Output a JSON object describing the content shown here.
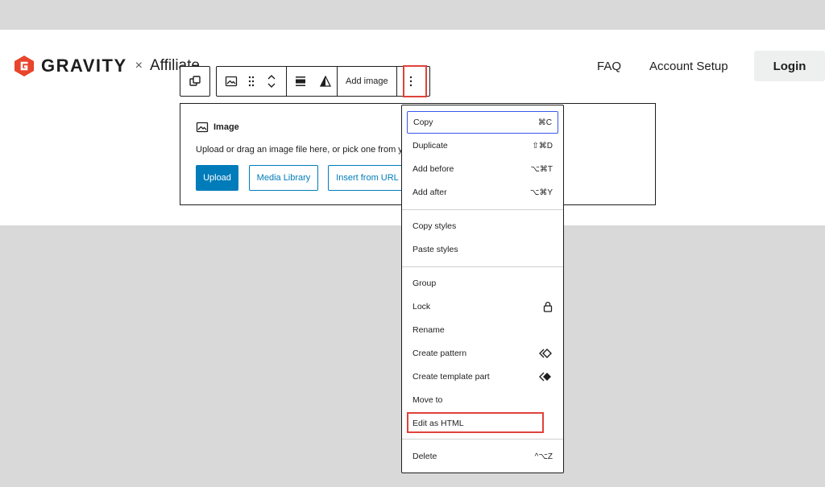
{
  "site": {
    "logo_text": "GRAVITY",
    "logo_separator": "×",
    "logo_partner": "Affiliate",
    "nav": [
      "FAQ",
      "Account Setup"
    ],
    "login_label": "Login",
    "brand_color": "#e8452c"
  },
  "toolbar": {
    "add_image_label": "Add image",
    "icons": [
      "transform-icon",
      "image-icon",
      "drag-handle-icon",
      "move-up-icon",
      "move-down-icon",
      "align-icon",
      "duotone-icon",
      "more-options-icon"
    ]
  },
  "placeholder": {
    "title": "Image",
    "description": "Upload or drag an image file here, or pick one from yo",
    "upload_label": "Upload",
    "media_library_label": "Media Library",
    "insert_url_label": "Insert from URL",
    "accent_color": "#007cba"
  },
  "menu": {
    "group1": [
      {
        "label": "Copy",
        "shortcut": "⌘C"
      },
      {
        "label": "Duplicate",
        "shortcut": "⇧⌘D"
      },
      {
        "label": "Add before",
        "shortcut": "⌥⌘T"
      },
      {
        "label": "Add after",
        "shortcut": "⌥⌘Y"
      }
    ],
    "group2": [
      {
        "label": "Copy styles"
      },
      {
        "label": "Paste styles"
      }
    ],
    "group3": [
      {
        "label": "Group"
      },
      {
        "label": "Lock",
        "icon": "lock-icon"
      },
      {
        "label": "Rename"
      },
      {
        "label": "Create pattern",
        "icon": "pattern-icon"
      },
      {
        "label": "Create template part",
        "icon": "template-part-icon"
      },
      {
        "label": "Move to"
      },
      {
        "label": "Edit as HTML"
      }
    ],
    "group4": [
      {
        "label": "Delete",
        "shortcut": "^⌥Z"
      }
    ],
    "highlight_color": "#e0423a"
  }
}
